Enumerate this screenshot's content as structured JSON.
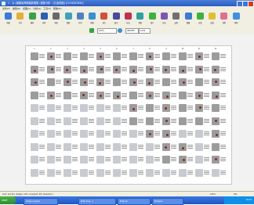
{
  "window": {
    "title": "1 - 大 (细胞培养图像数据集) 图像分析 - [孔板视图] [1234567890]",
    "controls": [
      "_",
      "□",
      "×"
    ]
  },
  "menu": [
    "文件(F)",
    "编辑(E)",
    "视图(V)",
    "分析(A)",
    "工具(T)",
    "帮助(H)"
  ],
  "toolbar": [
    {
      "label": "新建",
      "icon": "new-icon",
      "color": "#3a7bd5"
    },
    {
      "label": "打开",
      "icon": "open-icon",
      "color": "#e0b03a"
    },
    {
      "label": "刷新",
      "icon": "refresh-icon",
      "color": "#3aa04a"
    },
    {
      "label": "保存",
      "icon": "save-icon",
      "color": "#2f5fb0"
    },
    {
      "label": "拍照",
      "icon": "camera-icon",
      "color": "#6a6a6a"
    },
    {
      "label": "参数",
      "icon": "settings-icon",
      "color": "#40a0c0"
    },
    {
      "label": "打印",
      "icon": "print-icon",
      "color": "#5080c0"
    },
    {
      "label": "网格",
      "icon": "grid-icon",
      "color": "#3a90d0"
    },
    {
      "label": "放大",
      "icon": "zoom-icon",
      "color": "#d05040"
    },
    {
      "label": "缩小",
      "icon": "zoom-out-icon",
      "color": "#4a4a9a"
    },
    {
      "label": "标记",
      "icon": "marker-icon",
      "color": "#c03050"
    },
    {
      "label": "测量",
      "icon": "measure-icon",
      "color": "#30a0a0"
    },
    {
      "label": "统计",
      "icon": "stats-icon",
      "color": "#40b040"
    },
    {
      "label": "导出",
      "icon": "export-icon",
      "color": "#7a5ab0"
    },
    {
      "label": "设置",
      "icon": "gear-icon",
      "color": "#707070"
    },
    {
      "label": "视图",
      "icon": "view-icon",
      "color": "#3a7bd5"
    },
    {
      "label": "过滤",
      "icon": "filter-icon",
      "color": "#40b040"
    },
    {
      "label": "选择",
      "icon": "select-icon",
      "color": "#e0c030"
    },
    {
      "label": "清除",
      "icon": "clear-icon",
      "color": "#e07090"
    },
    {
      "label": "帮助",
      "icon": "help-icon",
      "color": "#4090e0"
    }
  ],
  "subbar": {
    "zoom": "100%",
    "field_a": "ABCDEF",
    "field_b": "1234"
  },
  "plate": {
    "columns": [
      "1",
      "2",
      "3",
      "4",
      "5",
      "6",
      "7",
      "8",
      "9",
      "10",
      "11",
      "12"
    ],
    "rows": 10,
    "wells": [
      [
        1,
        1,
        1,
        1,
        1,
        1,
        1,
        1,
        1,
        1,
        1,
        1
      ],
      [
        1,
        1,
        1,
        1,
        1,
        1,
        1,
        1,
        1,
        1,
        1,
        1
      ],
      [
        1,
        1,
        1,
        1,
        1,
        1,
        1,
        1,
        1,
        1,
        1,
        1
      ],
      [
        1,
        1,
        1,
        1,
        1,
        1,
        1,
        1,
        1,
        1,
        1,
        1
      ],
      [
        0,
        0,
        0,
        0,
        0,
        0,
        1,
        1,
        1,
        1,
        1,
        1
      ],
      [
        0,
        0,
        0,
        0,
        0,
        0,
        1,
        1,
        1,
        1,
        1,
        1
      ],
      [
        0,
        0,
        0,
        0,
        0,
        0,
        0,
        1,
        1,
        0,
        0,
        1
      ],
      [
        0,
        0,
        0,
        0,
        0,
        0,
        0,
        0,
        1,
        1,
        0,
        1
      ],
      [
        0,
        0,
        0,
        0,
        0,
        0,
        0,
        0,
        1,
        1,
        0,
        1
      ],
      [
        0,
        0,
        0,
        0,
        0,
        0,
        0,
        0,
        0,
        0,
        0,
        0
      ]
    ],
    "blobs": [
      [
        0,
        1,
        0,
        0,
        1,
        0,
        0,
        1,
        0,
        0,
        1,
        0
      ],
      [
        1,
        1,
        1,
        1,
        1,
        1,
        1,
        1,
        1,
        1,
        1,
        1
      ],
      [
        1,
        0,
        1,
        1,
        1,
        0,
        1,
        1,
        0,
        1,
        0,
        1
      ],
      [
        0,
        1,
        0,
        1,
        1,
        1,
        0,
        1,
        1,
        0,
        1,
        1
      ],
      [
        0,
        0,
        0,
        0,
        0,
        0,
        1,
        0,
        1,
        0,
        1,
        0
      ],
      [
        0,
        0,
        0,
        0,
        0,
        0,
        0,
        0,
        1,
        0,
        0,
        1
      ],
      [
        0,
        0,
        0,
        0,
        0,
        0,
        0,
        1,
        1,
        0,
        0,
        1
      ],
      [
        0,
        0,
        0,
        0,
        0,
        0,
        0,
        0,
        1,
        1,
        0,
        0
      ],
      [
        0,
        0,
        0,
        0,
        0,
        0,
        0,
        0,
        0,
        1,
        0,
        1
      ],
      [
        0,
        0,
        0,
        0,
        0,
        0,
        0,
        0,
        0,
        0,
        0,
        0
      ]
    ],
    "colors": {
      "well": "#9c9c9c",
      "well_light": "#c7cbcf",
      "blob": "#8a2a24"
    }
  },
  "status": {
    "left": "Grid: 12×10 | Images: 120 | Analyzed: 68 | Selected: 1",
    "right_a": "100%",
    "right_b": "Idle"
  },
  "taskbar": {
    "start": "start",
    "tasks": [
      "Image Analysis",
      "Plate View - 1",
      "Explorer",
      "Notepad"
    ],
    "clock": "10:24"
  }
}
